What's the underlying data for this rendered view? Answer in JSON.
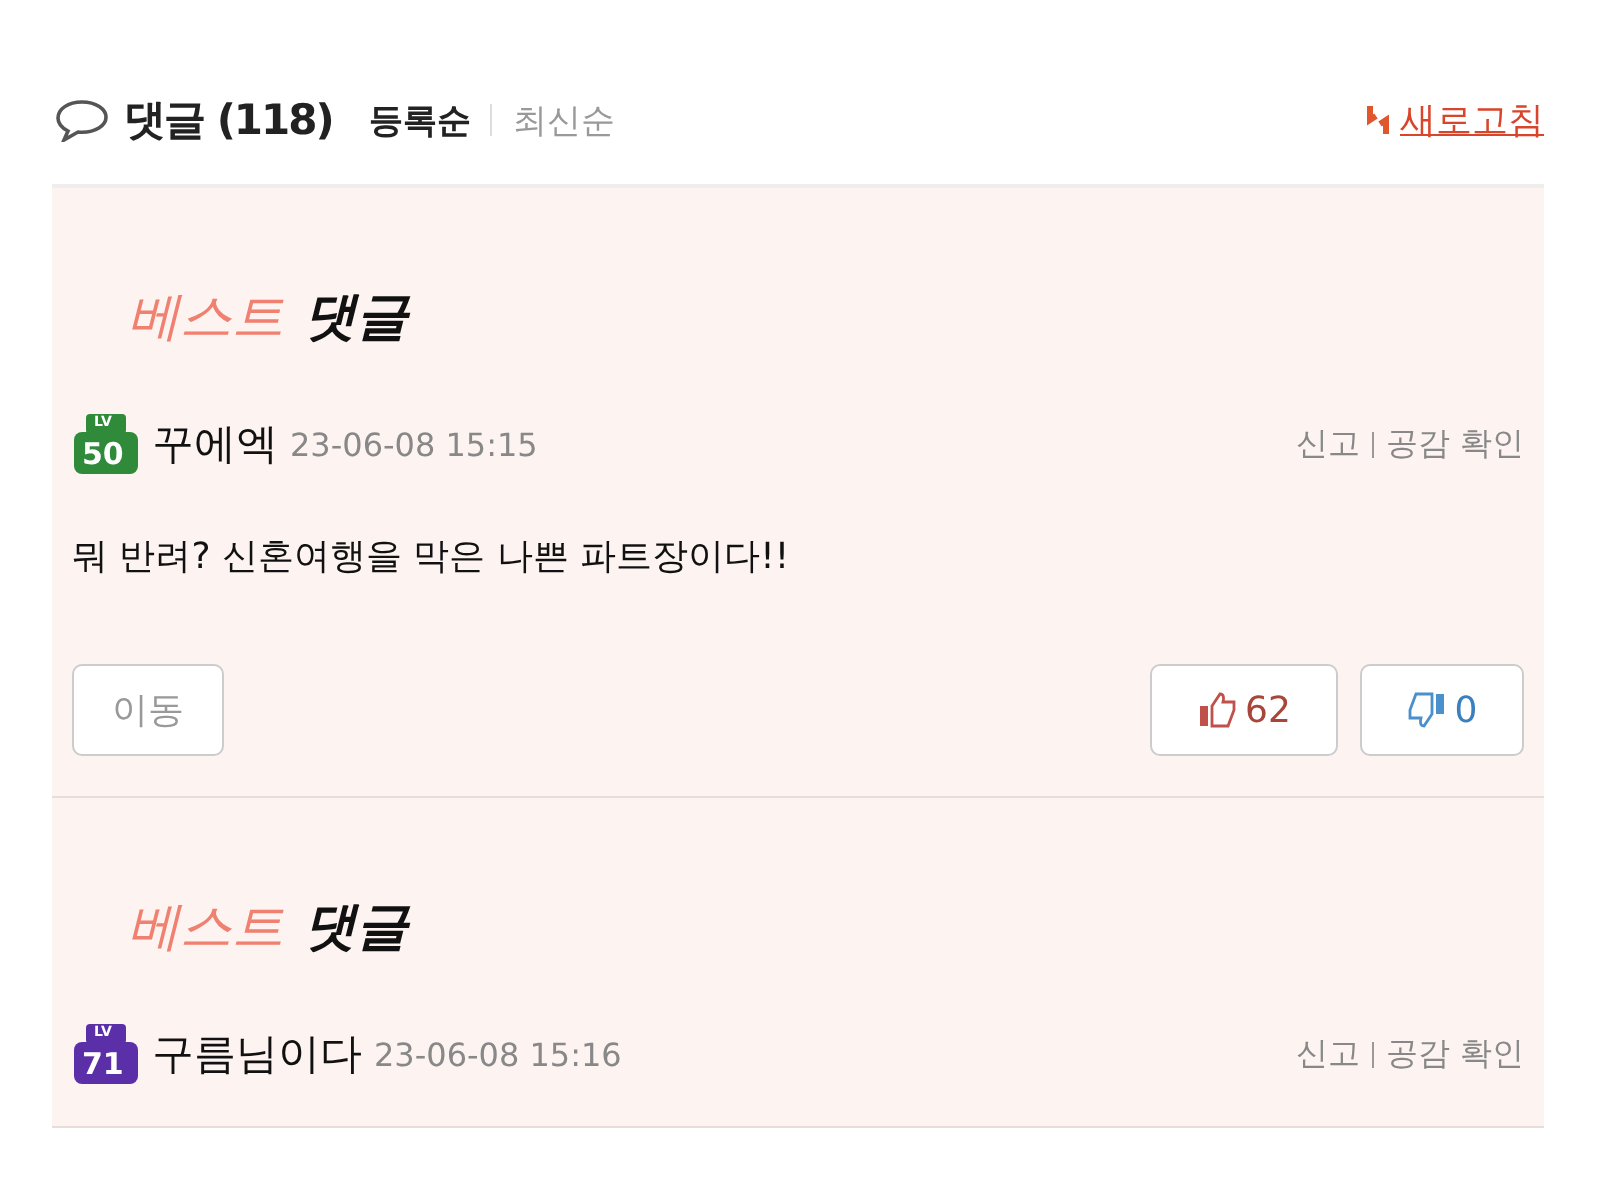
{
  "header": {
    "title": "댓글",
    "count": "(118)",
    "sort_options": [
      {
        "label": "등록순",
        "selected": true
      },
      {
        "label": "최신순",
        "selected": false
      }
    ],
    "refresh": "새로고침"
  },
  "comments": [
    {
      "best_label": {
        "accent": "베스트",
        "rest": "댓글"
      },
      "level_badge": {
        "label": "LV",
        "number": "50",
        "color": "#2f8a3a"
      },
      "author": "꾸에엑",
      "date": "23-06-08 15:15",
      "actions": [
        "신고",
        "공감 확인"
      ],
      "text": "뭐 반려? 신혼여행을 막은 나쁜 파트장이다!!",
      "move_button": "이동",
      "likes": "62",
      "dislikes": "0"
    },
    {
      "best_label": {
        "accent": "베스트",
        "rest": "댓글"
      },
      "level_badge": {
        "label": "LV",
        "number": "71",
        "color": "#5b2fa8"
      },
      "author": "구름님이다",
      "date": "23-06-08 15:16",
      "actions": [
        "신고",
        "공감 확인"
      ]
    }
  ]
}
